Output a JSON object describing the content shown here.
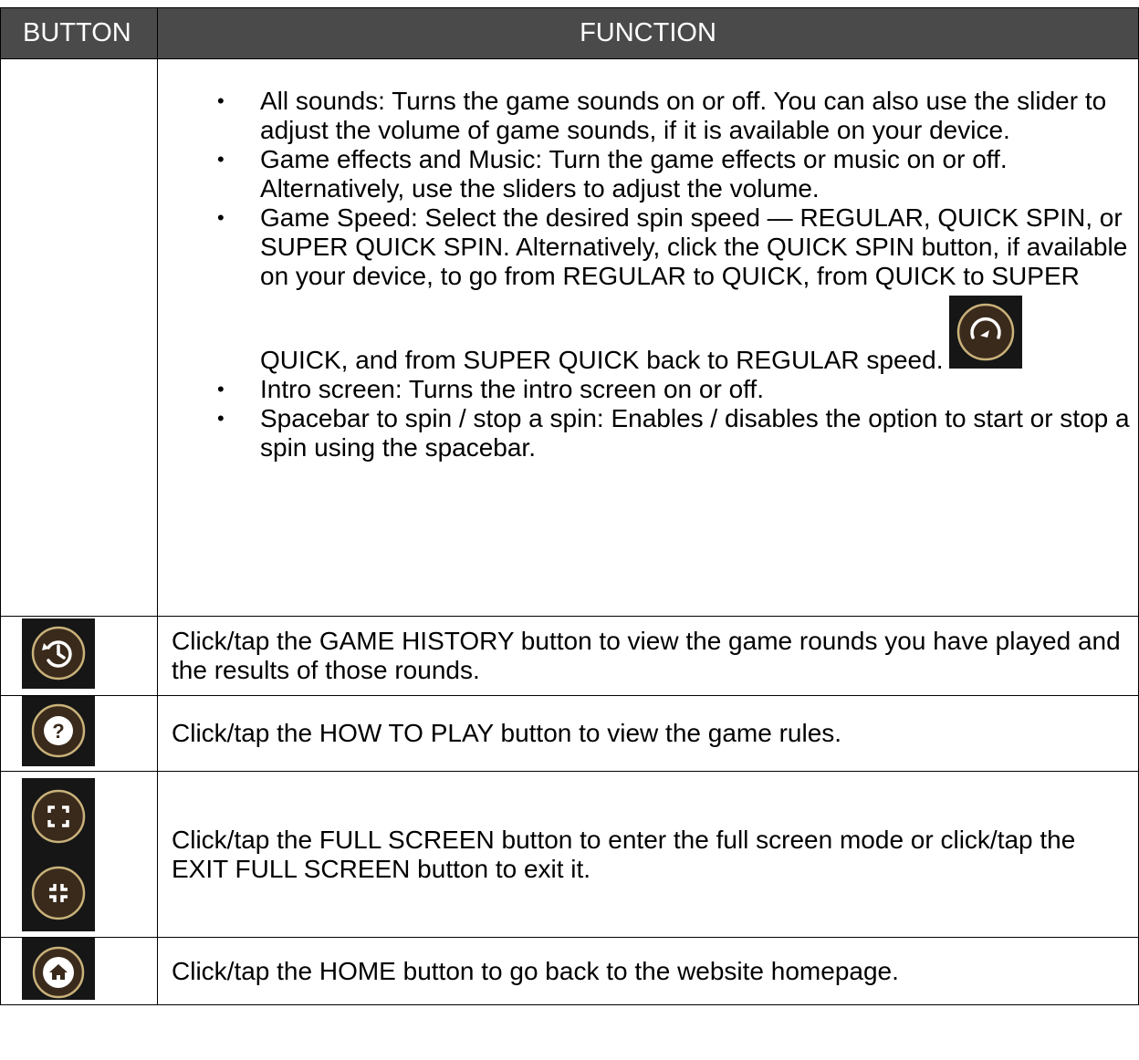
{
  "header": {
    "button": "BUTTON",
    "function": "FUNCTION"
  },
  "settings": {
    "bullets": [
      "All sounds: Turns the game sounds on or off. You can also use the slider to adjust the volume of game sounds, if it is available on your device.",
      "Game effects and Music: Turn the game effects or music on or off. Alternatively, use the sliders to adjust the volume.",
      "Game Speed: Select the desired spin speed — REGULAR, QUICK SPIN, or SUPER QUICK SPIN. Alternatively, click the QUICK SPIN button, if available on your device, to go from REGULAR to QUICK, from QUICK to SUPER QUICK, and from SUPER QUICK back to REGULAR speed.",
      "Intro screen: Turns the intro screen on or off.",
      "Spacebar to spin / stop a spin: Enables / disables the option to start or stop a spin using the spacebar."
    ],
    "speed_icon": "quick-spin-icon"
  },
  "rows": [
    {
      "icon": "history-icon",
      "text": "Click/tap the GAME HISTORY button to view the game rounds you have played and the results of those rounds."
    },
    {
      "icon": "help-icon",
      "text": "Click/tap the HOW TO PLAY button to view the game rules."
    },
    {
      "icons": [
        "fullscreen-icon",
        "exit-fullscreen-icon"
      ],
      "text": "Click/tap the FULL SCREEN button to enter the full screen mode or click/tap the EXIT FULL SCREEN button to exit it."
    },
    {
      "icon": "home-icon",
      "text": "Click/tap the HOME button to go back to the website homepage."
    }
  ],
  "colors": {
    "header_bg": "#4a4a4a",
    "icon_bg": "#161616",
    "icon_ring": "#c9b27a",
    "icon_fill": "#3a2a1c"
  }
}
